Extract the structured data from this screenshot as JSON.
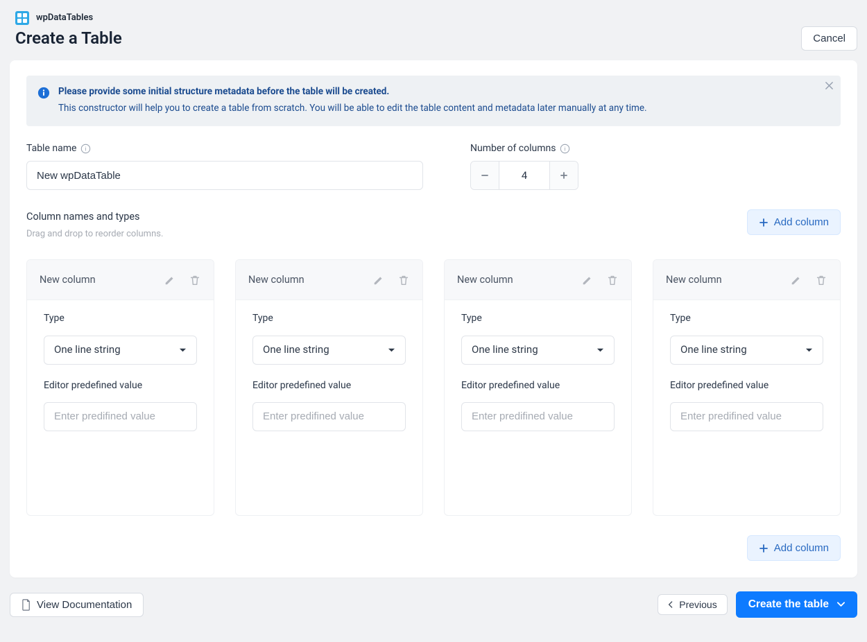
{
  "brand": "wpDataTables",
  "pageTitle": "Create a Table",
  "cancel": "Cancel",
  "alert": {
    "title": "Please provide some initial structure metadata before the table will be created.",
    "desc": "This constructor will help you to create a table from scratch. You will be able to edit the table content and metadata later manually at any time."
  },
  "tableName": {
    "label": "Table name",
    "value": "New wpDataTable"
  },
  "numCols": {
    "label": "Number of columns",
    "value": "4"
  },
  "section": {
    "heading": "Column names and types",
    "sub": "Drag and drop to reorder columns."
  },
  "addColumn": "Add column",
  "columns": [
    {
      "name": "New column",
      "typeLabel": "Type",
      "type": "One line string",
      "predefLabel": "Editor predefined value",
      "predefPlaceholder": "Enter predifined value"
    },
    {
      "name": "New column",
      "typeLabel": "Type",
      "type": "One line string",
      "predefLabel": "Editor predefined value",
      "predefPlaceholder": "Enter predifined value"
    },
    {
      "name": "New column",
      "typeLabel": "Type",
      "type": "One line string",
      "predefLabel": "Editor predefined value",
      "predefPlaceholder": "Enter predifined value"
    },
    {
      "name": "New column",
      "typeLabel": "Type",
      "type": "One line string",
      "predefLabel": "Editor predefined value",
      "predefPlaceholder": "Enter predifined value"
    }
  ],
  "footer": {
    "docs": "View Documentation",
    "previous": "Previous",
    "create": "Create the table"
  }
}
